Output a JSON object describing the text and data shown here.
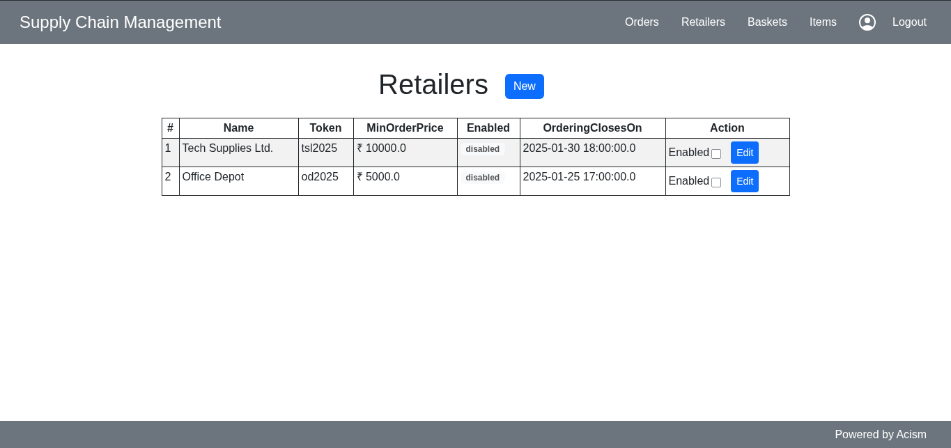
{
  "navbar": {
    "brand": "Supply Chain Management",
    "links": [
      "Orders",
      "Retailers",
      "Baskets",
      "Items"
    ],
    "logout": "Logout"
  },
  "header": {
    "title": "Retailers",
    "new_button": "New"
  },
  "table": {
    "columns": [
      "#",
      "Name",
      "Token",
      "MinOrderPrice",
      "Enabled",
      "OrderingClosesOn",
      "Action"
    ],
    "rows": [
      {
        "index": "1",
        "name": "Tech Supplies Ltd.",
        "token": "tsl2025",
        "min_order_price": "₹ 10000.0",
        "status": "disabled",
        "ordering_closes_on": "2025-01-30 18:00:00.0",
        "checkbox_label": "Enabled",
        "checked": false,
        "edit_button": "Edit"
      },
      {
        "index": "2",
        "name": "Office Depot",
        "token": "od2025",
        "min_order_price": "₹ 5000.0",
        "status": "disabled",
        "ordering_closes_on": "2025-01-25 17:00:00.0",
        "checkbox_label": "Enabled",
        "checked": false,
        "edit_button": "Edit"
      }
    ]
  },
  "footer": {
    "text": "Powered by Acism"
  }
}
